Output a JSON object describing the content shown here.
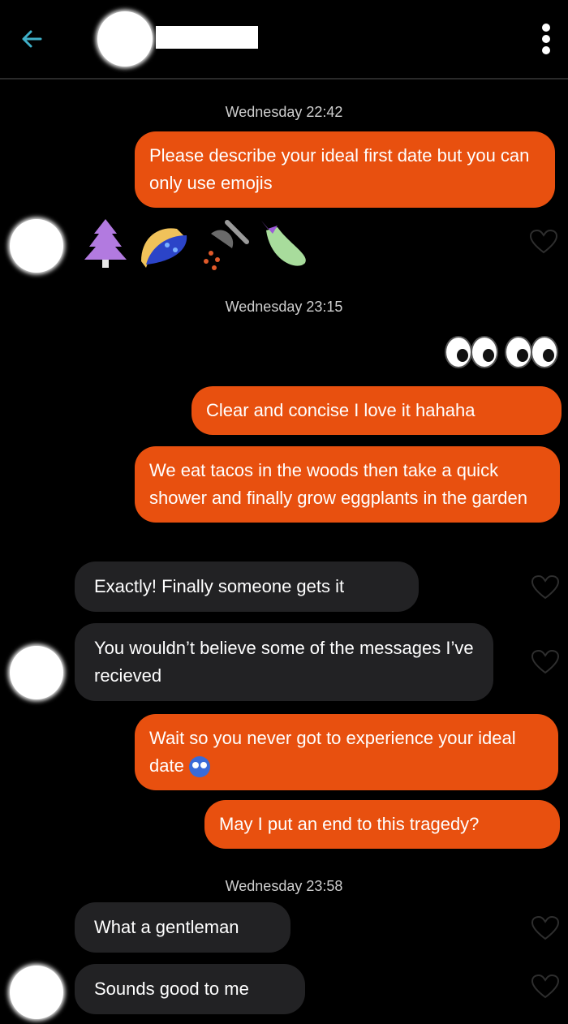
{
  "header": {
    "back_icon": "arrow-left-icon",
    "menu_icon": "more-vertical-icon",
    "accent_color": "#3fb0c8"
  },
  "messages": {
    "ts1": "Wednesday 22:42",
    "m1": "Please describe your ideal first date but you can only use emojis",
    "ts2": "Wednesday 23:15",
    "m3": "Clear and concise I love it hahaha",
    "m4": "We eat tacos in the woods then take a quick shower and finally grow eggplants in the garden",
    "m5": "Exactly! Finally someone gets it",
    "m6": "You wouldn’t believe some of the messages I’ve recieved",
    "m7": "Wait so you never got to experience your ideal date",
    "m8": "May I put an end to this tragedy?",
    "ts3": "Wednesday 23:58",
    "m9": "What a gentleman",
    "m10": "Sounds good to me"
  },
  "emoji_reply": [
    "evergreen-tree",
    "taco",
    "shower",
    "eggplant"
  ],
  "eyes_reply": [
    "eyes",
    "eyes"
  ],
  "colors": {
    "outgoing": "#e8500f",
    "incoming": "#222224",
    "background": "#000000"
  }
}
